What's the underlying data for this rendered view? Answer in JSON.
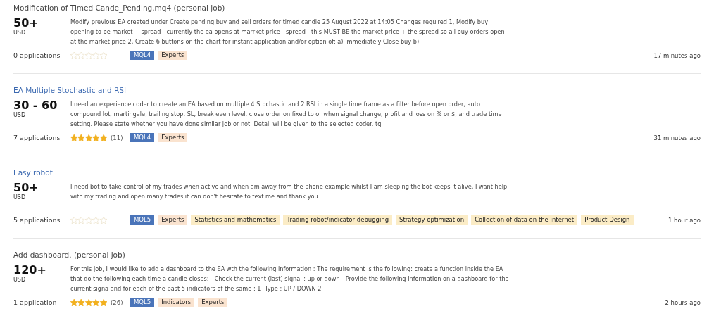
{
  "jobs": [
    {
      "title": "Modification of Timed Cande_Pending.mq4 (personal job)",
      "kind": "personal",
      "price": "50+",
      "currency": "USD",
      "description": "Modify previous EA created under Create pending buy and sell orders for timed candle 25 August 2022 at 14:05 Changes required 1, Modify buy opening to be market + spread - currently the ea opens at marrket price - spread - this MUST BE the market price + the spread so all buy orders open at the market price 2, Create 6 buttons on the chart for instant application and/or option of: a) Immediately Close buy b)",
      "applications": "0 applications",
      "stars": 0,
      "tags": [
        {
          "label": "MQL4",
          "kind": "platform"
        },
        {
          "label": "Experts",
          "kind": "category"
        }
      ],
      "time": "17 minutes ago"
    },
    {
      "title": "EA Multiple Stochastic and RSI",
      "kind": "public",
      "price": "30 - 60",
      "currency": "USD",
      "description": "I need an experience coder to create an EA based on multiple 4 Stochastic and 2 RSI in a single time frame as a filter before open order, auto compound lot, martingale, trailing stop, SL, break even level, close order on fixed tp or when signal change, profit and loss on % or $, and trade time setting. Please state whether you have done similar job or not. Detail will be given to the selected coder. tq",
      "applications": "7 applications",
      "stars": 5,
      "reviews": "(11)",
      "tags": [
        {
          "label": "MQL4",
          "kind": "platform"
        },
        {
          "label": "Experts",
          "kind": "category"
        }
      ],
      "time": "31 minutes ago"
    },
    {
      "title": "Easy robot",
      "kind": "public",
      "price": "50+",
      "currency": "USD",
      "description": "I need bot to take control of my trades when active and when am away from the phone example whilst I am sleeping the bot keeps it alive, I want help with my trading and open many trades it can don't hesitate to text me and thank you",
      "applications": "5 applications",
      "stars": 0,
      "tags": [
        {
          "label": "MQL5",
          "kind": "platform"
        },
        {
          "label": "Experts",
          "kind": "category"
        },
        {
          "label": "Statistics and mathematics",
          "kind": "skill"
        },
        {
          "label": "Trading robot/indicator debugging",
          "kind": "skill"
        },
        {
          "label": "Strategy optimization",
          "kind": "skill"
        },
        {
          "label": "Collection of data on the internet",
          "kind": "skill"
        },
        {
          "label": "Product Design",
          "kind": "skill"
        }
      ],
      "time": "1 hour ago"
    },
    {
      "title": "Add dashboard. (personal job)",
      "kind": "personal",
      "price": "120+",
      "currency": "USD",
      "description": "For this job, I would like to add a dashboard to the EA wth the following information : The requirement is the following: create a function inside the EA that do the following each time a candle closes: - Check the current (last) signal : up or down - Provide the following information on a dashboard for the current signa and for each of the past 5 indicators of the same : 1- Type : UP / DOWN 2-",
      "applications": "1 application",
      "stars": 5,
      "reviews": "(26)",
      "tags": [
        {
          "label": "MQL5",
          "kind": "platform"
        },
        {
          "label": "Indicators",
          "kind": "category"
        },
        {
          "label": "Experts",
          "kind": "category"
        }
      ],
      "time": "2 hours ago"
    }
  ]
}
